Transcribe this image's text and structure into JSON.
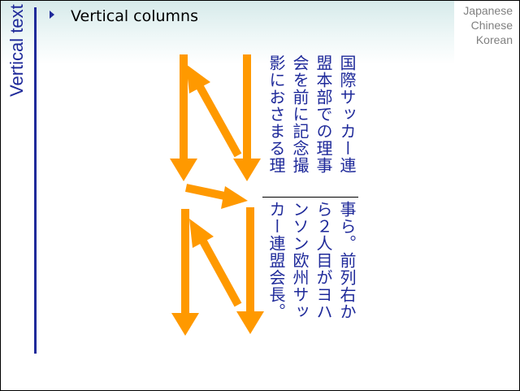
{
  "slide": {
    "title": "Vertical columns",
    "side_title": "Vertical text",
    "languages": [
      "Japanese",
      "Chinese",
      "Korean"
    ],
    "colors": {
      "accent": "#1f2a9a",
      "arrow": "#ff9900"
    },
    "icons": [
      "bullet-triangle-icon",
      "down-arrow-icon",
      "up-arrow-icon",
      "right-arrow-icon"
    ]
  },
  "vertical_text": {
    "top_columns": [
      "国際サッカー連",
      "盟本部での理事",
      "会を前に記念撮",
      "影におさまる理"
    ],
    "bottom_columns": [
      "事ら。前列右か",
      "ら２人目がヨハ",
      "ンソン欧州サッ",
      "カー連盟会長。"
    ]
  }
}
